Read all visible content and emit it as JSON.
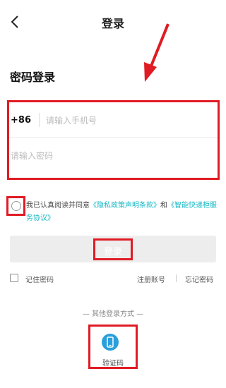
{
  "header": {
    "title": "登录"
  },
  "section_title": "密码登录",
  "form": {
    "country_code": "+86",
    "phone_placeholder": "请输入手机号",
    "password_placeholder": "请输入密码"
  },
  "agreement": {
    "prefix": "我已认真阅读并同意",
    "privacy_link": "《隐私政策声明条款》",
    "conjunction": "和",
    "service_link": "《智能快递柜服务协议》"
  },
  "login_button": "登录",
  "options": {
    "remember": "记住密码",
    "register": "注册账号",
    "forgot": "忘记密码"
  },
  "other_login": {
    "title": "— 其他登录方式 —",
    "code_label": "验证码"
  },
  "colors": {
    "highlight": "#e01b24",
    "link": "#19b8c5",
    "icon": "#2a9fdc"
  },
  "icons": [
    "back-chevron-icon",
    "phone-icon",
    "red-arrow-annotation"
  ]
}
